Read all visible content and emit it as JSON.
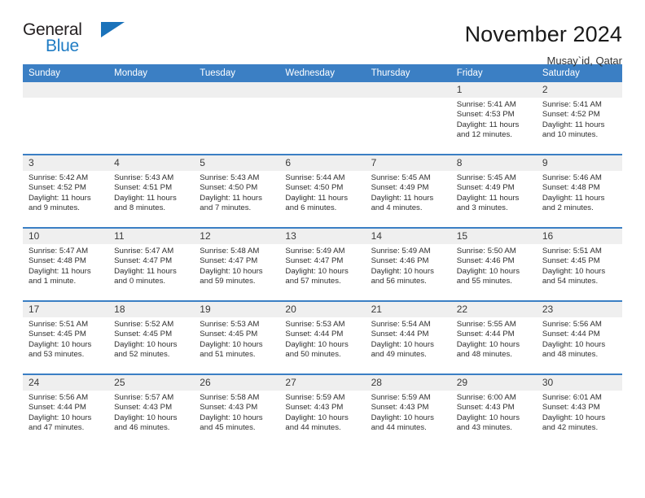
{
  "brand": {
    "word_one": "General",
    "word_two": "Blue",
    "triangle_icon": "brand-triangle-icon",
    "accent_color": "#1f7cc4"
  },
  "header": {
    "title": "November 2024",
    "subtitle": "Musay`id, Qatar"
  },
  "calendar": {
    "header_color": "#3b7fc4",
    "daynum_bg": "#efefef",
    "weekdays": [
      "Sunday",
      "Monday",
      "Tuesday",
      "Wednesday",
      "Thursday",
      "Friday",
      "Saturday"
    ],
    "weeks": [
      [
        {
          "day": "",
          "empty": true
        },
        {
          "day": "",
          "empty": true
        },
        {
          "day": "",
          "empty": true
        },
        {
          "day": "",
          "empty": true
        },
        {
          "day": "",
          "empty": true
        },
        {
          "day": "1",
          "sunrise": "Sunrise: 5:41 AM",
          "sunset": "Sunset: 4:53 PM",
          "daylight": "Daylight: 11 hours and 12 minutes."
        },
        {
          "day": "2",
          "sunrise": "Sunrise: 5:41 AM",
          "sunset": "Sunset: 4:52 PM",
          "daylight": "Daylight: 11 hours and 10 minutes."
        }
      ],
      [
        {
          "day": "3",
          "sunrise": "Sunrise: 5:42 AM",
          "sunset": "Sunset: 4:52 PM",
          "daylight": "Daylight: 11 hours and 9 minutes."
        },
        {
          "day": "4",
          "sunrise": "Sunrise: 5:43 AM",
          "sunset": "Sunset: 4:51 PM",
          "daylight": "Daylight: 11 hours and 8 minutes."
        },
        {
          "day": "5",
          "sunrise": "Sunrise: 5:43 AM",
          "sunset": "Sunset: 4:50 PM",
          "daylight": "Daylight: 11 hours and 7 minutes."
        },
        {
          "day": "6",
          "sunrise": "Sunrise: 5:44 AM",
          "sunset": "Sunset: 4:50 PM",
          "daylight": "Daylight: 11 hours and 6 minutes."
        },
        {
          "day": "7",
          "sunrise": "Sunrise: 5:45 AM",
          "sunset": "Sunset: 4:49 PM",
          "daylight": "Daylight: 11 hours and 4 minutes."
        },
        {
          "day": "8",
          "sunrise": "Sunrise: 5:45 AM",
          "sunset": "Sunset: 4:49 PM",
          "daylight": "Daylight: 11 hours and 3 minutes."
        },
        {
          "day": "9",
          "sunrise": "Sunrise: 5:46 AM",
          "sunset": "Sunset: 4:48 PM",
          "daylight": "Daylight: 11 hours and 2 minutes."
        }
      ],
      [
        {
          "day": "10",
          "sunrise": "Sunrise: 5:47 AM",
          "sunset": "Sunset: 4:48 PM",
          "daylight": "Daylight: 11 hours and 1 minute."
        },
        {
          "day": "11",
          "sunrise": "Sunrise: 5:47 AM",
          "sunset": "Sunset: 4:47 PM",
          "daylight": "Daylight: 11 hours and 0 minutes."
        },
        {
          "day": "12",
          "sunrise": "Sunrise: 5:48 AM",
          "sunset": "Sunset: 4:47 PM",
          "daylight": "Daylight: 10 hours and 59 minutes."
        },
        {
          "day": "13",
          "sunrise": "Sunrise: 5:49 AM",
          "sunset": "Sunset: 4:47 PM",
          "daylight": "Daylight: 10 hours and 57 minutes."
        },
        {
          "day": "14",
          "sunrise": "Sunrise: 5:49 AM",
          "sunset": "Sunset: 4:46 PM",
          "daylight": "Daylight: 10 hours and 56 minutes."
        },
        {
          "day": "15",
          "sunrise": "Sunrise: 5:50 AM",
          "sunset": "Sunset: 4:46 PM",
          "daylight": "Daylight: 10 hours and 55 minutes."
        },
        {
          "day": "16",
          "sunrise": "Sunrise: 5:51 AM",
          "sunset": "Sunset: 4:45 PM",
          "daylight": "Daylight: 10 hours and 54 minutes."
        }
      ],
      [
        {
          "day": "17",
          "sunrise": "Sunrise: 5:51 AM",
          "sunset": "Sunset: 4:45 PM",
          "daylight": "Daylight: 10 hours and 53 minutes."
        },
        {
          "day": "18",
          "sunrise": "Sunrise: 5:52 AM",
          "sunset": "Sunset: 4:45 PM",
          "daylight": "Daylight: 10 hours and 52 minutes."
        },
        {
          "day": "19",
          "sunrise": "Sunrise: 5:53 AM",
          "sunset": "Sunset: 4:45 PM",
          "daylight": "Daylight: 10 hours and 51 minutes."
        },
        {
          "day": "20",
          "sunrise": "Sunrise: 5:53 AM",
          "sunset": "Sunset: 4:44 PM",
          "daylight": "Daylight: 10 hours and 50 minutes."
        },
        {
          "day": "21",
          "sunrise": "Sunrise: 5:54 AM",
          "sunset": "Sunset: 4:44 PM",
          "daylight": "Daylight: 10 hours and 49 minutes."
        },
        {
          "day": "22",
          "sunrise": "Sunrise: 5:55 AM",
          "sunset": "Sunset: 4:44 PM",
          "daylight": "Daylight: 10 hours and 48 minutes."
        },
        {
          "day": "23",
          "sunrise": "Sunrise: 5:56 AM",
          "sunset": "Sunset: 4:44 PM",
          "daylight": "Daylight: 10 hours and 48 minutes."
        }
      ],
      [
        {
          "day": "24",
          "sunrise": "Sunrise: 5:56 AM",
          "sunset": "Sunset: 4:44 PM",
          "daylight": "Daylight: 10 hours and 47 minutes."
        },
        {
          "day": "25",
          "sunrise": "Sunrise: 5:57 AM",
          "sunset": "Sunset: 4:43 PM",
          "daylight": "Daylight: 10 hours and 46 minutes."
        },
        {
          "day": "26",
          "sunrise": "Sunrise: 5:58 AM",
          "sunset": "Sunset: 4:43 PM",
          "daylight": "Daylight: 10 hours and 45 minutes."
        },
        {
          "day": "27",
          "sunrise": "Sunrise: 5:59 AM",
          "sunset": "Sunset: 4:43 PM",
          "daylight": "Daylight: 10 hours and 44 minutes."
        },
        {
          "day": "28",
          "sunrise": "Sunrise: 5:59 AM",
          "sunset": "Sunset: 4:43 PM",
          "daylight": "Daylight: 10 hours and 44 minutes."
        },
        {
          "day": "29",
          "sunrise": "Sunrise: 6:00 AM",
          "sunset": "Sunset: 4:43 PM",
          "daylight": "Daylight: 10 hours and 43 minutes."
        },
        {
          "day": "30",
          "sunrise": "Sunrise: 6:01 AM",
          "sunset": "Sunset: 4:43 PM",
          "daylight": "Daylight: 10 hours and 42 minutes."
        }
      ]
    ]
  }
}
